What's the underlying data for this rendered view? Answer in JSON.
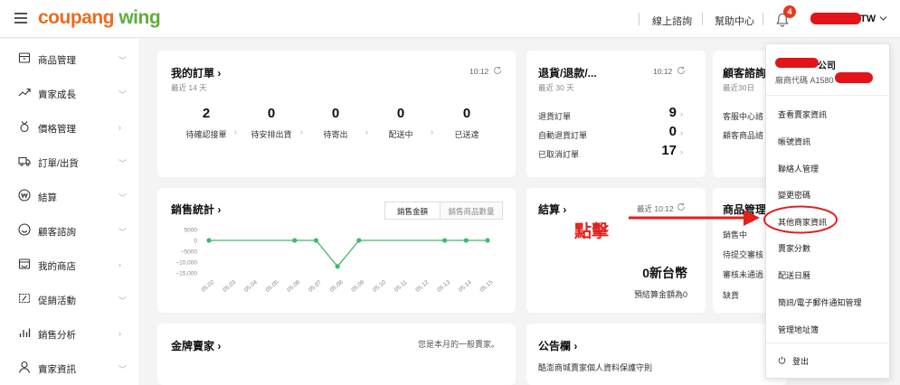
{
  "header": {
    "logo_part1": "coupang",
    "logo_part2": "wing",
    "links": [
      "線上諮詢",
      "幫助中心"
    ],
    "notification_count": "4",
    "user_suffix": "TW"
  },
  "sidebar": {
    "items": [
      {
        "label": "商品管理",
        "icon": "box-icon"
      },
      {
        "label": "賣家成長",
        "icon": "trend-icon"
      },
      {
        "label": "價格管理",
        "icon": "price-tag-icon"
      },
      {
        "label": "訂單/出貨",
        "icon": "truck-icon"
      },
      {
        "label": "結算",
        "icon": "won-icon"
      },
      {
        "label": "顧客諮詢",
        "icon": "smile-icon"
      },
      {
        "label": "我的商店",
        "icon": "store-icon"
      },
      {
        "label": "促銷活動",
        "icon": "promo-icon"
      },
      {
        "label": "銷售分析",
        "icon": "bar-chart-icon"
      },
      {
        "label": "賣家資訊",
        "icon": "person-icon"
      }
    ]
  },
  "orders": {
    "title": "我的訂單",
    "period": "最近 14 天",
    "time": "10:12",
    "steps": [
      {
        "value": "2",
        "label": "待確認接單"
      },
      {
        "value": "0",
        "label": "待安排出貨"
      },
      {
        "value": "0",
        "label": "待寄出"
      },
      {
        "value": "0",
        "label": "配送中"
      },
      {
        "value": "0",
        "label": "已送達"
      }
    ]
  },
  "returns": {
    "title": "退貨/退款/...",
    "period": "最近 30 天",
    "time": "10:12",
    "rows": [
      {
        "label": "退貨訂單",
        "value": "9"
      },
      {
        "label": "自動退貨訂單",
        "value": "0"
      },
      {
        "label": "已取消訂單",
        "value": "17"
      }
    ]
  },
  "consult": {
    "title": "顧客諮詢",
    "period": "最近30日",
    "rows": [
      "客服中心諮",
      "顧客商品諮"
    ]
  },
  "sales": {
    "title": "銷售統計",
    "tabs": [
      "銷售金額",
      "銷售商品數量"
    ]
  },
  "chart_data": {
    "type": "line",
    "categories": [
      "05.02",
      "05.03",
      "05.04",
      "05.05",
      "05.06",
      "05.07",
      "05.08",
      "05.09",
      "05.10",
      "05.11",
      "05.12",
      "05.13",
      "05.14",
      "05.15"
    ],
    "values": [
      0,
      0,
      0,
      0,
      0,
      0,
      -12000,
      0,
      0,
      0,
      0,
      0,
      0,
      0
    ],
    "yticks": [
      "5000",
      "0",
      "−5000",
      "−10,000",
      "−15,000"
    ],
    "ylim": [
      -15000,
      5000
    ],
    "color": "#3fb96b",
    "grid": false,
    "legend": "none"
  },
  "settlement": {
    "title": "結算",
    "time": "最近 10:12",
    "amount": "0新台幣",
    "note": "預結算金額為0"
  },
  "product_mgmt": {
    "title": "商品管理",
    "rows": [
      "銷售中",
      "待提交審核",
      "審核未通過",
      "缺貨"
    ]
  },
  "gold": {
    "title": "金牌賣家",
    "note": "您是本月的一般賣家。"
  },
  "notice": {
    "title": "公告欄",
    "line1": "酷澎商城賣家個人資料保護守則"
  },
  "dropdown": {
    "company_suffix": "公司",
    "vendor_code": "廠商代碼 A1580",
    "items": [
      "查看賣家資訊",
      "帳號資訊",
      "聯絡人管理",
      "變更密碼",
      "其他商家資訊",
      "賣家分數",
      "配送日曆",
      "簡訊/電子郵件通知管理",
      "管理地址簿"
    ],
    "logout": "登出"
  },
  "annotation": {
    "text": "點擊",
    "color": "#e3201b"
  }
}
